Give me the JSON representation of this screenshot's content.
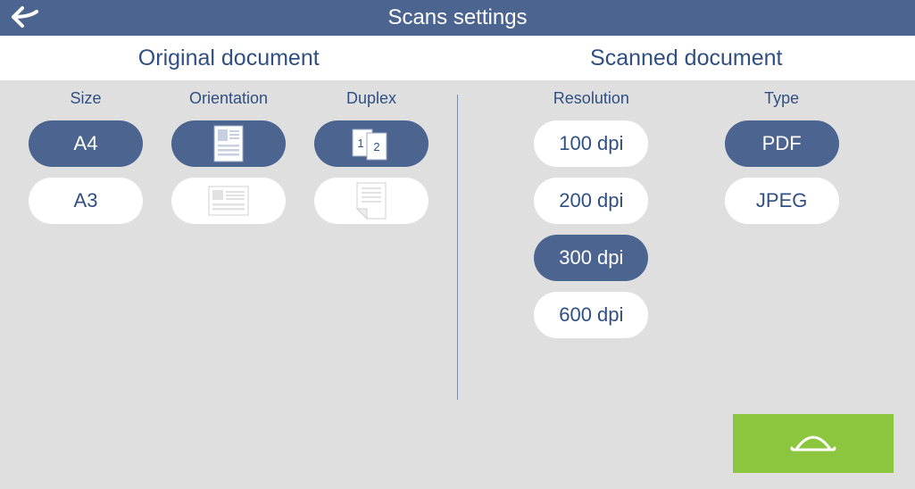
{
  "title": "Scans settings",
  "sections": {
    "original": "Original document",
    "scanned": "Scanned document"
  },
  "original": {
    "size": {
      "label": "Size",
      "options": [
        "A4",
        "A3"
      ],
      "selected": "A4"
    },
    "orientation": {
      "label": "Orientation",
      "options": [
        "portrait",
        "landscape"
      ],
      "selected": "portrait"
    },
    "duplex": {
      "label": "Duplex",
      "options": [
        "duplex",
        "simplex"
      ],
      "selected": "duplex"
    }
  },
  "scanned": {
    "resolution": {
      "label": "Resolution",
      "options": [
        "100 dpi",
        "200 dpi",
        "300 dpi",
        "600 dpi"
      ],
      "selected": "300 dpi"
    },
    "type": {
      "label": "Type",
      "options": [
        "PDF",
        "JPEG"
      ],
      "selected": "PDF"
    }
  },
  "colors": {
    "accent": "#4c6490",
    "action": "#8cc63f",
    "text": "#304f82"
  }
}
